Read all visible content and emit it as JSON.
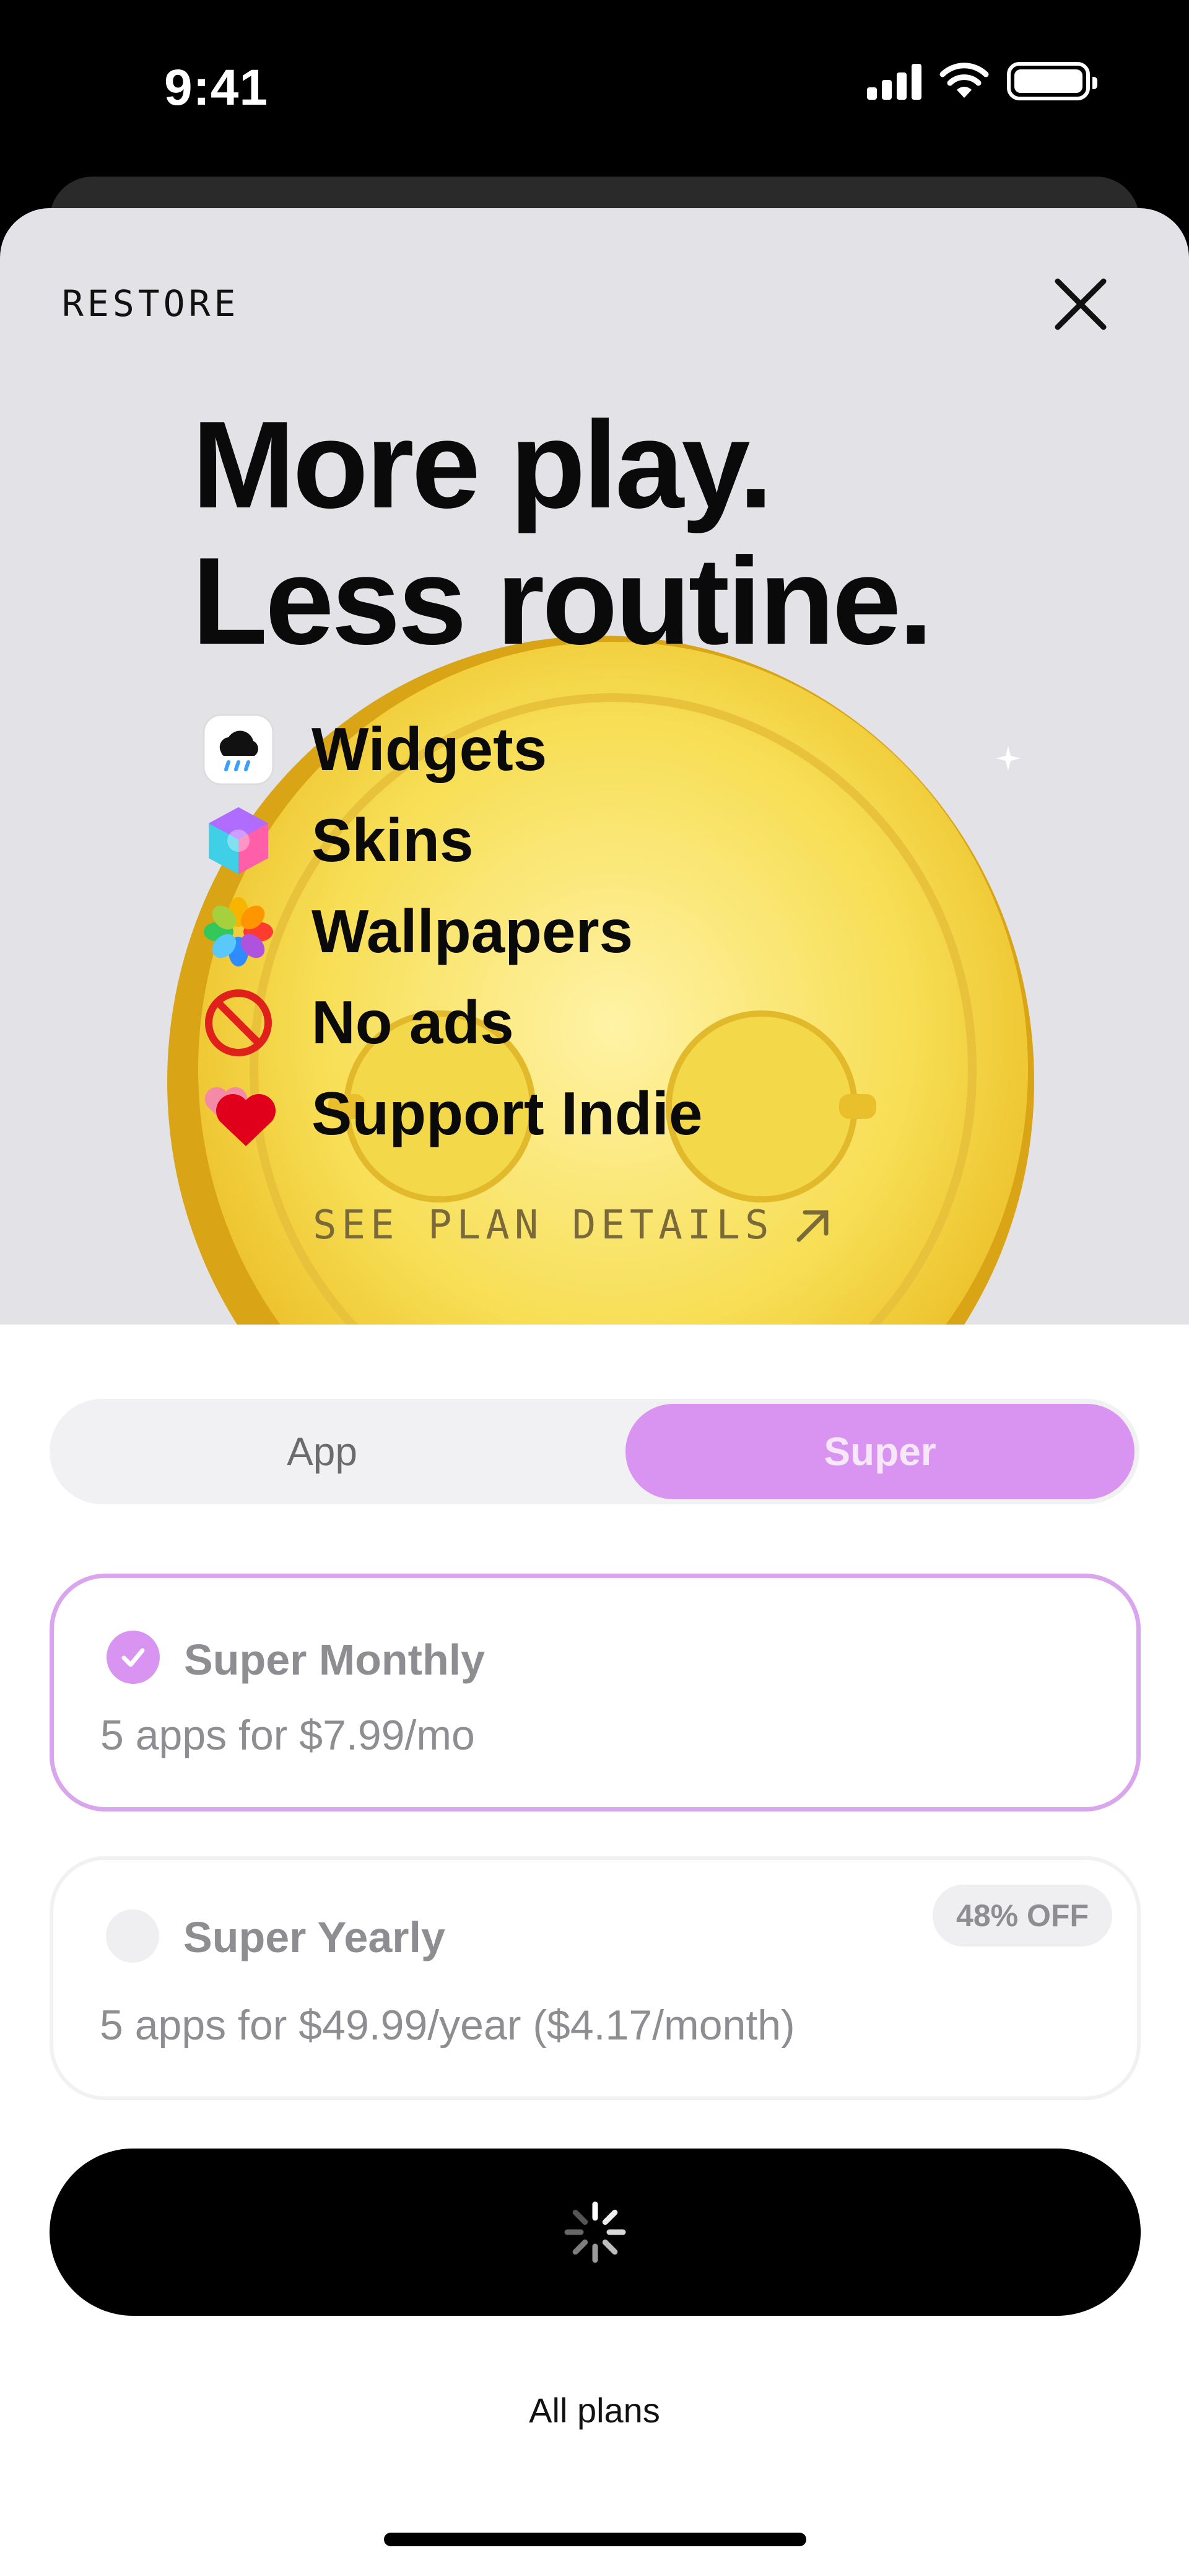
{
  "status_bar": {
    "time": "9:41"
  },
  "header": {
    "restore_label": "RESTORE"
  },
  "hero": {
    "headline_line1": "More play.",
    "headline_line2": "Less routine.",
    "features": [
      {
        "label": "Widgets",
        "icon": "cloud-rain-icon"
      },
      {
        "label": "Skins",
        "icon": "hexagon-skins-icon"
      },
      {
        "label": "Wallpapers",
        "icon": "flower-photos-icon"
      },
      {
        "label": "No ads",
        "icon": "no-sign-icon"
      },
      {
        "label": "Support Indie",
        "icon": "hearts-icon"
      }
    ],
    "see_plan_details": "SEE PLAN DETAILS"
  },
  "segmented": {
    "app_label": "App",
    "super_label": "Super",
    "selected": "Super"
  },
  "plans": [
    {
      "title": "Super Monthly",
      "description": "5 apps for $7.99/mo",
      "selected": true
    },
    {
      "title": "Super Yearly",
      "description": "5 apps for $49.99/year ($4.17/month)",
      "badge": "48% OFF",
      "selected": false
    }
  ],
  "cta": {
    "state": "loading"
  },
  "footer": {
    "all_plans_label": "All plans"
  },
  "colors": {
    "accent": "#d894f0",
    "accent_border": "#d9a6ee",
    "hero_bg": "#e3e2e6",
    "coin": "#f4d43a"
  }
}
